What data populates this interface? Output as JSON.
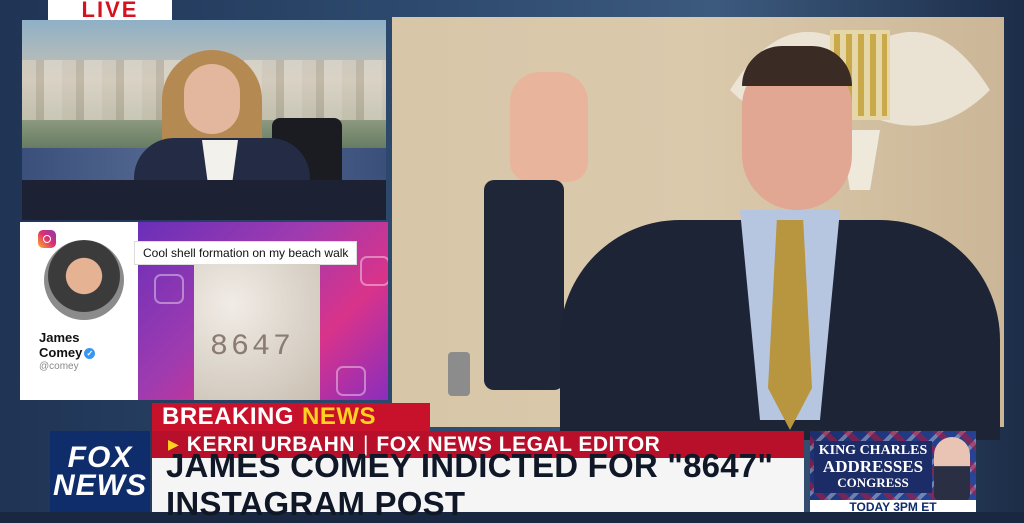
{
  "live_tag": "LIVE",
  "instagram_post": {
    "author_name": "James Comey",
    "handle": "@comey",
    "caption": "Cool shell formation on my beach walk",
    "shell_text": "8647"
  },
  "lower_third": {
    "breaking_label_1": "BREAKING",
    "breaking_label_2": "NEWS",
    "guest_name": "KERRI URBAHN",
    "separator": "|",
    "guest_title": "FOX NEWS LEGAL EDITOR",
    "headline": "JAMES COMEY INDICTED FOR \"8647\" INSTAGRAM POST"
  },
  "network_logo": {
    "line1": "FOX",
    "line2": "NEWS"
  },
  "promo": {
    "line1": "KING CHARLES",
    "line2": "ADDRESSES",
    "line3": "CONGRESS",
    "bottom": "TODAY 3PM ET"
  },
  "colors": {
    "breaking_red": "#c8122b",
    "news_yellow": "#ffd21f",
    "fox_blue": "#0f2c6b"
  }
}
